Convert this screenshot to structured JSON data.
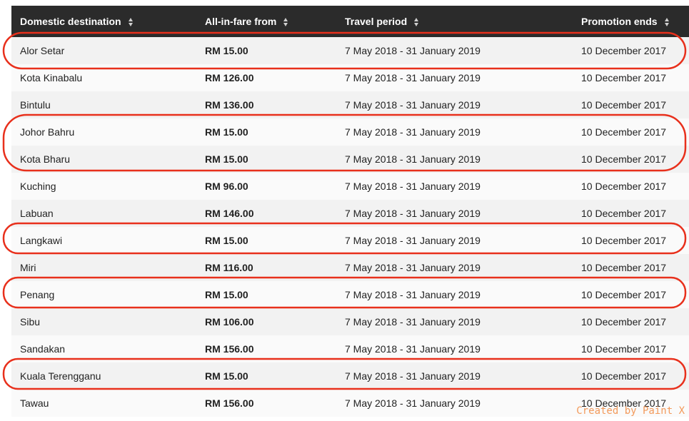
{
  "table": {
    "headers": [
      {
        "label": "Domestic destination"
      },
      {
        "label": "All-in-fare from"
      },
      {
        "label": "Travel period"
      },
      {
        "label": "Promotion ends"
      }
    ],
    "rows": [
      {
        "destination": "Alor Setar",
        "fare": "RM 15.00",
        "travel_period": "7 May 2018 - 31 January 2019",
        "promo_ends": "10 December 2017"
      },
      {
        "destination": "Kota Kinabalu",
        "fare": "RM 126.00",
        "travel_period": "7 May 2018 - 31 January 2019",
        "promo_ends": "10 December 2017"
      },
      {
        "destination": "Bintulu",
        "fare": "RM 136.00",
        "travel_period": "7 May 2018 - 31 January 2019",
        "promo_ends": "10 December 2017"
      },
      {
        "destination": "Johor Bahru",
        "fare": "RM 15.00",
        "travel_period": "7 May 2018 - 31 January 2019",
        "promo_ends": "10 December 2017"
      },
      {
        "destination": "Kota Bharu",
        "fare": "RM 15.00",
        "travel_period": "7 May 2018 - 31 January 2019",
        "promo_ends": "10 December 2017"
      },
      {
        "destination": "Kuching",
        "fare": "RM 96.00",
        "travel_period": "7 May 2018 - 31 January 2019",
        "promo_ends": "10 December 2017"
      },
      {
        "destination": "Labuan",
        "fare": "RM 146.00",
        "travel_period": "7 May 2018 - 31 January 2019",
        "promo_ends": "10 December 2017"
      },
      {
        "destination": "Langkawi",
        "fare": "RM 15.00",
        "travel_period": "7 May 2018 - 31 January 2019",
        "promo_ends": "10 December 2017"
      },
      {
        "destination": "Miri",
        "fare": "RM 116.00",
        "travel_period": "7 May 2018 - 31 January 2019",
        "promo_ends": "10 December 2017"
      },
      {
        "destination": "Penang",
        "fare": "RM 15.00",
        "travel_period": "7 May 2018 - 31 January 2019",
        "promo_ends": "10 December 2017"
      },
      {
        "destination": "Sibu",
        "fare": "RM 106.00",
        "travel_period": "7 May 2018 - 31 January 2019",
        "promo_ends": "10 December 2017"
      },
      {
        "destination": "Sandakan",
        "fare": "RM 156.00",
        "travel_period": "7 May 2018 - 31 January 2019",
        "promo_ends": "10 December 2017"
      },
      {
        "destination": "Kuala Terengganu",
        "fare": "RM 15.00",
        "travel_period": "7 May 2018 - 31 January 2019",
        "promo_ends": "10 December 2017"
      },
      {
        "destination": "Tawau",
        "fare": "RM 156.00",
        "travel_period": "7 May 2018 - 31 January 2019",
        "promo_ends": "10 December 2017"
      }
    ]
  },
  "highlight_color": "#e8301c",
  "header_bg": "#2b2b2b",
  "watermark": "Created by Paint X"
}
